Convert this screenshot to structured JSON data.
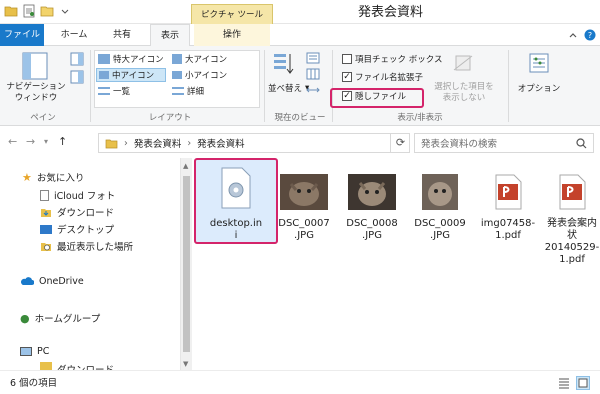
{
  "titlebar": {
    "context_tab": "ピクチャ ツール",
    "window_title": "発表会資料"
  },
  "ribbon_tabs": {
    "file": "ファイル",
    "home": "ホーム",
    "share": "共有",
    "view": "表示",
    "manage": "操作"
  },
  "ribbon": {
    "pane": {
      "nav_pane_line1": "ナビゲーション",
      "nav_pane_line2": "ウィンドウ",
      "group": "ペイン"
    },
    "layout": {
      "extra_large": "特大アイコン",
      "large": "大アイコン",
      "medium": "中アイコン",
      "small": "小アイコン",
      "list": "一覧",
      "details": "詳細",
      "group": "レイアウト"
    },
    "current_view": {
      "sort_by": "並べ替え",
      "group": "現在のビュー"
    },
    "show_hide": {
      "item_checkboxes": "項目チェック ボックス",
      "file_extensions": "ファイル名拡張子",
      "hidden_items": "隠しファイル",
      "hide_selected_line1": "選択した項目を",
      "hide_selected_line2": "表示しない",
      "group": "表示/非表示"
    },
    "options": "オプション"
  },
  "address": {
    "path": [
      "発表会資料",
      "発表会資料"
    ],
    "search_placeholder": "発表会資料の検索"
  },
  "nav": {
    "favorites": "お気に入り",
    "icloud": "iCloud フォト",
    "downloads": "ダウンロード",
    "desktop": "デスクトップ",
    "recent": "最近表示した場所",
    "onedrive": "OneDrive",
    "homegroup": "ホームグループ",
    "pc": "PC",
    "pc_downloads": "ダウンロード"
  },
  "files": [
    {
      "name": "desktop.ini",
      "line1": "desktop.in",
      "line2": "i",
      "kind": "settings-file-icon"
    },
    {
      "name": "DSC_0007.JPG",
      "line1": "DSC_0007",
      "line2": ".JPG",
      "kind": "cat-photo"
    },
    {
      "name": "DSC_0008.JPG",
      "line1": "DSC_0008",
      "line2": ".JPG",
      "kind": "cat-photo"
    },
    {
      "name": "DSC_0009.JPG",
      "line1": "DSC_0009",
      "line2": ".JPG",
      "kind": "cat-photo"
    },
    {
      "name": "img07458-1.pdf",
      "line1": "img07458-",
      "line2": "1.pdf",
      "kind": "pdf-icon"
    },
    {
      "name": "発表会案内状20140529-1.pdf",
      "line1": "発表会案内",
      "line2": "状",
      "line3": "20140529-",
      "line4": "1.pdf",
      "kind": "pdf-icon"
    }
  ],
  "status": {
    "count": "6 個の項目"
  },
  "colors": {
    "accent": "#1979ca",
    "highlight": "#d4246a",
    "context_tab": "#f5e6a8",
    "pdf": "#c4422b"
  }
}
